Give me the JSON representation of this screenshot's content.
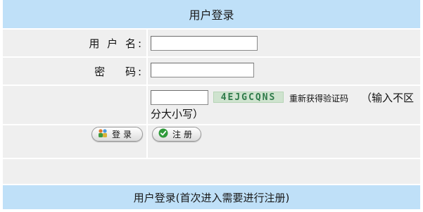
{
  "header": {
    "title": "用户登录"
  },
  "form": {
    "username_label": "用 户 名:",
    "username_value": "",
    "password_label": "密　 码:",
    "password_value": "",
    "captcha_value": "",
    "captcha_image_text": "4EJGCQNS",
    "refresh_captcha_label": "重新获得验证码",
    "captcha_hint_part1": "（输入不区",
    "captcha_hint_part2": "分大小写）"
  },
  "buttons": {
    "login_label": "登录",
    "register_label": "注册"
  },
  "footer": {
    "text": "用户登录(首次进入需要进行注册)"
  },
  "icons": {
    "login": "users-group-icon",
    "register": "check-circle-icon"
  },
  "colors": {
    "header_bg": "#bfe0f8",
    "cell_bg": "#efefef",
    "captcha_text": "#2f7a4a"
  }
}
